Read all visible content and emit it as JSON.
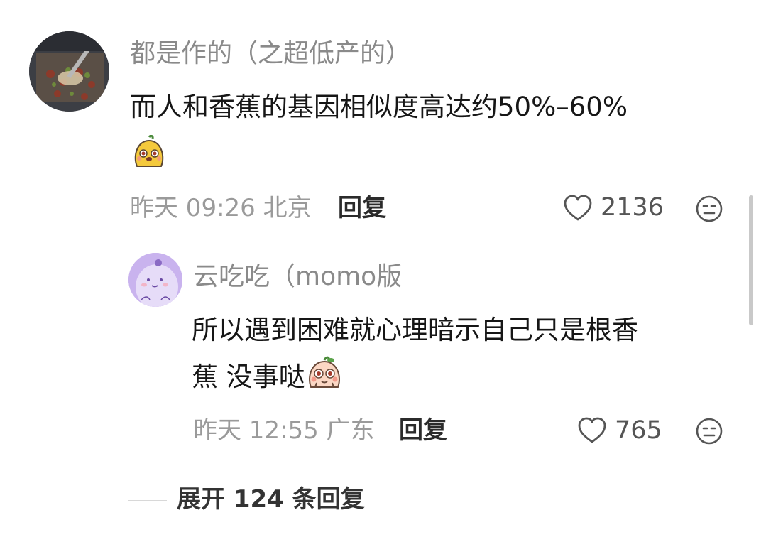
{
  "comments": [
    {
      "username": "都是作的（之超低产的）",
      "text_lines": [
        "而人和香蕉的基因相似度高达约50%–60%"
      ],
      "emoji": "yellow-sticker-emoji",
      "time": "昨天 09:26",
      "location": "北京",
      "reply_label": "回复",
      "likes": "2136",
      "dislike_icon": "neutral-face-icon",
      "like_icon": "heart-outline-icon",
      "avatar": "food-photo-avatar"
    },
    {
      "username": "云吃吃（momo版",
      "text_lines": [
        "所以遇到困难就心理暗示自己只是根香",
        "蕉 没事哒"
      ],
      "emoji": "peach-sticker-emoji",
      "time": "昨天 12:55",
      "location": "广东",
      "reply_label": "回复",
      "likes": "765",
      "dislike_icon": "neutral-face-icon",
      "like_icon": "heart-outline-icon",
      "avatar": "purple-cartoon-avatar"
    }
  ],
  "expand_replies": {
    "label": "展开 124 条回复"
  },
  "colors": {
    "text_primary": "#161616",
    "text_secondary": "#8a8a8a",
    "background": "#ffffff"
  }
}
